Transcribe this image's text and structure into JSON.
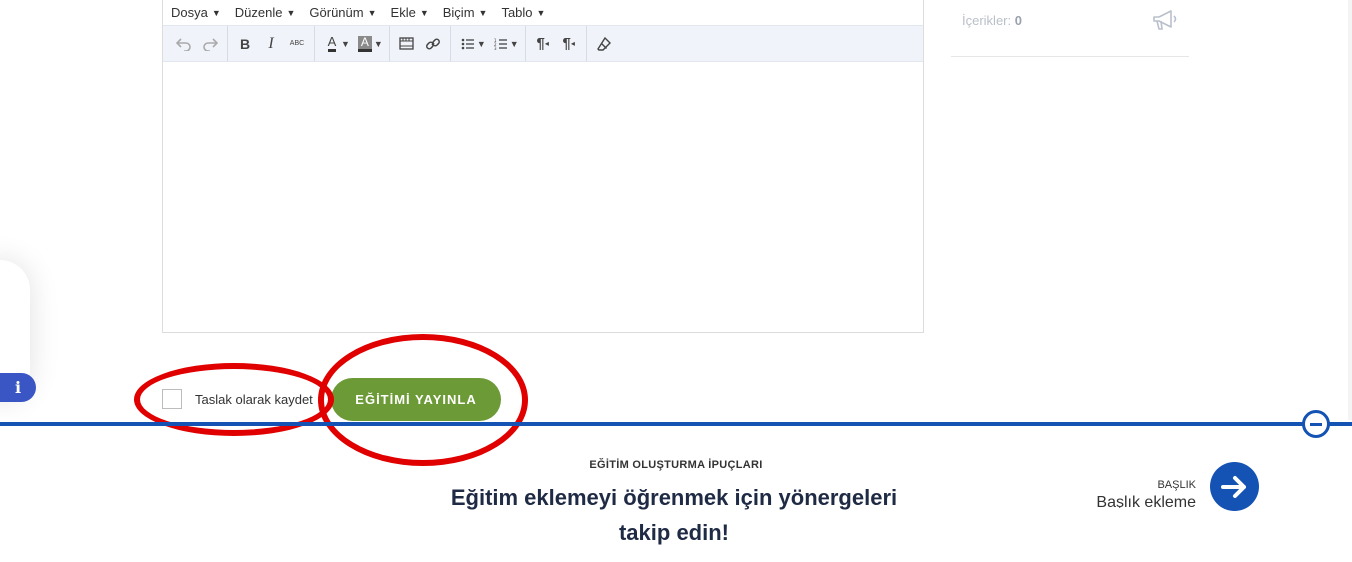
{
  "editor": {
    "menu": [
      {
        "label": "Dosya"
      },
      {
        "label": "Düzenle"
      },
      {
        "label": "Görünüm"
      },
      {
        "label": "Ekle"
      },
      {
        "label": "Biçim"
      },
      {
        "label": "Tablo"
      }
    ],
    "toolbar_icons": [
      "undo-icon",
      "redo-icon",
      "bold-icon",
      "italic-icon",
      "strikethrough-icon",
      "text-color-icon",
      "background-color-icon",
      "media-icon",
      "link-icon",
      "bullet-list-icon",
      "numbered-list-icon",
      "ltr-icon",
      "rtl-icon",
      "clear-format-icon"
    ],
    "bold_glyph": "B",
    "italic_glyph": "I",
    "strike_glyph": "ABC",
    "text_color_glyph": "A",
    "bg_color_glyph": "A"
  },
  "right_panel": {
    "stat_label": "İçerikler:",
    "stat_value": "0"
  },
  "form": {
    "draft_label": "Taslak olarak kaydet",
    "publish_label": "EĞİTİMİ YAYINLA"
  },
  "tips": {
    "title": "EĞİTİM OLUŞTURMA İPUÇLARI",
    "text": "Eğitim eklemeyi öğrenmek için yönergeleri takip edin!",
    "step_label": "BAŞLIK",
    "step_value": "Başlık ekleme"
  },
  "colors": {
    "publish": "#6c9a36",
    "accent_blue": "#1452b3",
    "annotation_red": "#e00000",
    "info": "#3a56c5"
  }
}
